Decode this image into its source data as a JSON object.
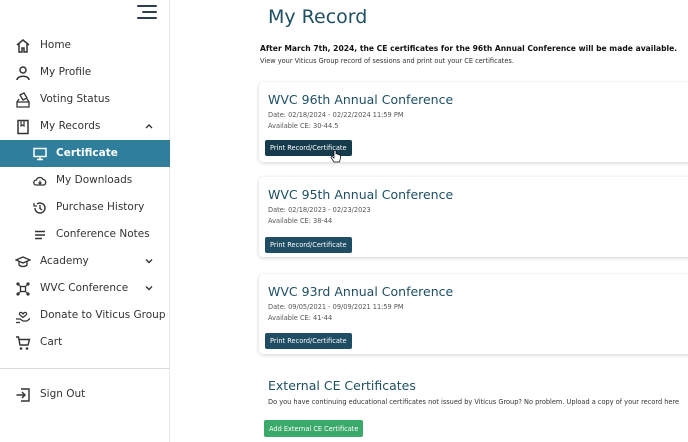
{
  "sidebar": {
    "items": [
      {
        "label": "Home",
        "icon": "home-icon"
      },
      {
        "label": "My Profile",
        "icon": "person-icon"
      },
      {
        "label": "Voting Status",
        "icon": "vote-icon"
      },
      {
        "label": "My Records",
        "icon": "book-icon",
        "expanded": true
      },
      {
        "label": "Certificate",
        "icon": "monitor-icon",
        "active": true
      },
      {
        "label": "My Downloads",
        "icon": "cloud-download-icon"
      },
      {
        "label": "Purchase History",
        "icon": "history-icon"
      },
      {
        "label": "Conference Notes",
        "icon": "notes-icon"
      },
      {
        "label": "Academy",
        "icon": "graduation-cap-icon"
      },
      {
        "label": "WVC Conference",
        "icon": "network-icon"
      },
      {
        "label": "Donate to Viticus Group",
        "icon": "donate-icon"
      },
      {
        "label": "Cart",
        "icon": "cart-icon"
      }
    ],
    "sign_out": "Sign Out",
    "active_color": "#2f7e9c"
  },
  "main": {
    "title": "My Record",
    "notice": "After March 7th, 2024, the CE certificates for the 96th Annual Conference will be made available.",
    "subnotice": "View your Viticus Group record of sessions and print out your CE certificates.",
    "cards": [
      {
        "title": "WVC 96th Annual Conference",
        "date": "Date: 02/18/2024 - 02/22/2024 11:59 PM",
        "ce": "Available CE: 30-44.5",
        "button": "Print Record/Certificate"
      },
      {
        "title": "WVC 95th Annual Conference",
        "date": "Date: 02/18/2023 - 02/23/2023",
        "ce": "Available CE: 38-44",
        "button": "Print Record/Certificate"
      },
      {
        "title": "WVC 93rd Annual Conference",
        "date": "Date: 09/05/2021 - 09/09/2021 11:59 PM",
        "ce": "Available CE: 41-44",
        "button": "Print Record/Certificate"
      }
    ],
    "external": {
      "title": "External CE Certificates",
      "text": "Do you have continuing educational certificates not issued by Viticus Group? No problem. Upload a copy of your record here",
      "button": "Add External CE Certificate"
    }
  },
  "colors": {
    "brand_dark": "#1f4d63",
    "title": "#1e4f63",
    "green": "#3aa96a"
  }
}
